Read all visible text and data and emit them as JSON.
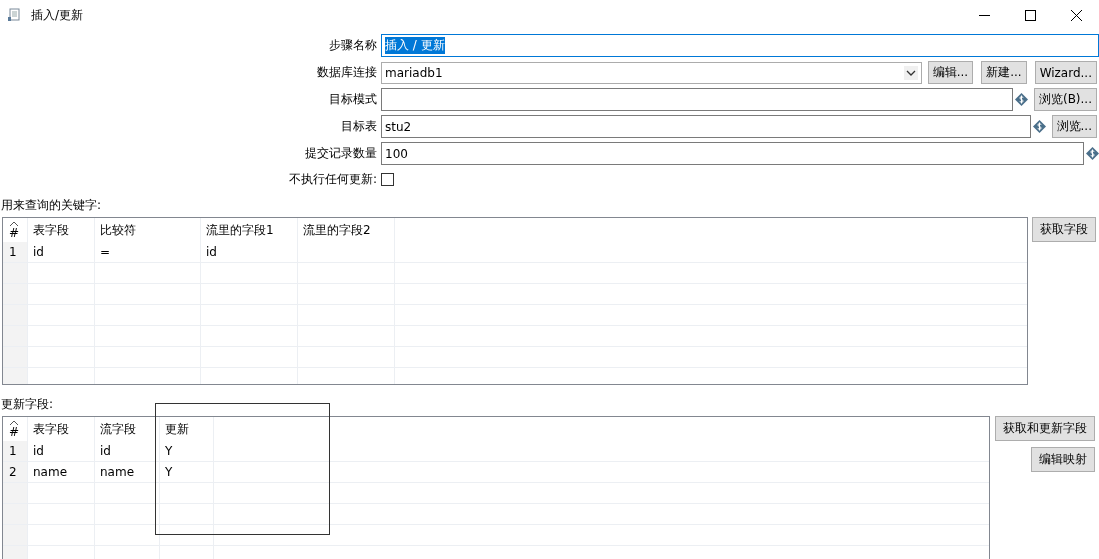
{
  "window": {
    "title": "插入/更新"
  },
  "form": [
    {
      "kind": "text",
      "label": "步骤名称",
      "value": "插入 / 更新",
      "focused": true,
      "selected": true
    },
    {
      "kind": "combo",
      "label": "数据库连接",
      "value": "mariadb1",
      "buttons": [
        "编辑...",
        "新建...",
        "Wizard..."
      ]
    },
    {
      "kind": "text",
      "label": "目标模式",
      "variable": true,
      "buttons": [
        "浏览(B)..."
      ]
    },
    {
      "kind": "text",
      "label": "目标表",
      "value": "stu2",
      "variable": true,
      "buttons": [
        "浏览..."
      ]
    },
    {
      "kind": "text",
      "label": "提交记录数量",
      "value": "100",
      "variable": true
    },
    {
      "kind": "checkbox",
      "label": "不执行任何更新:",
      "checked": false
    }
  ],
  "keys": {
    "label": "用来查询的关键字:",
    "columns": [
      "#",
      "表字段",
      "比较符",
      "流里的字段1",
      "流里的字段2"
    ],
    "rows": [
      [
        "1",
        "id",
        "=",
        "id"
      ]
    ],
    "buttons": [
      "获取字段"
    ]
  },
  "updates": {
    "label": "更新字段:",
    "columns": [
      "#",
      "表字段",
      "流字段",
      "更新"
    ],
    "rows": [
      [
        "1",
        "id",
        "id",
        "Y"
      ],
      [
        "2",
        "name",
        "name",
        "Y"
      ]
    ],
    "buttons": [
      "获取和更新字段",
      "编辑映射"
    ]
  }
}
